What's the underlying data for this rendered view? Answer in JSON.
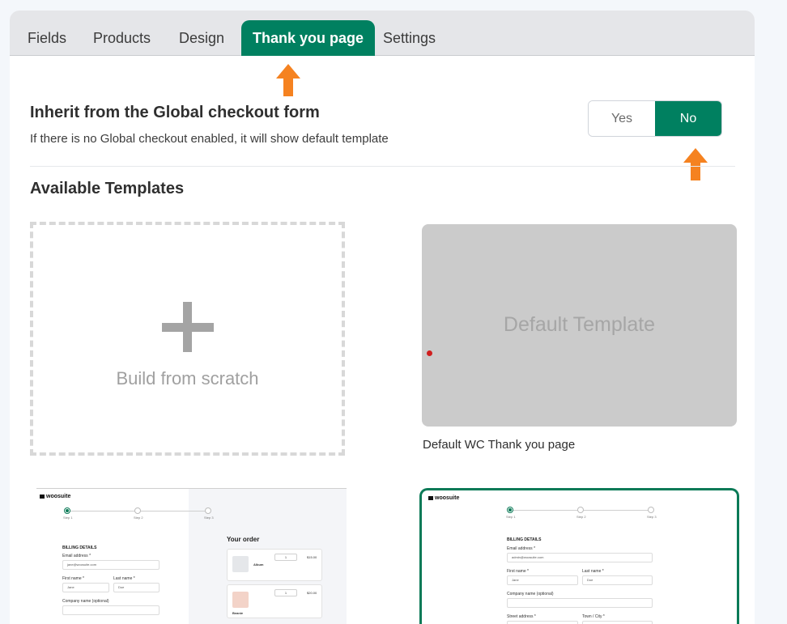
{
  "tabs": [
    {
      "label": "Fields",
      "active": false
    },
    {
      "label": "Products",
      "active": false
    },
    {
      "label": "Design",
      "active": false
    },
    {
      "label": "Thank you page",
      "active": true
    },
    {
      "label": "Settings",
      "active": false
    }
  ],
  "inherit": {
    "title": "Inherit from the Global checkout form",
    "subtitle": "If there is no Global checkout enabled, it will show default template",
    "yes_label": "Yes",
    "no_label": "No",
    "selected": "No"
  },
  "templates": {
    "title": "Available Templates",
    "scratch_label": "Build from scratch",
    "default_card_label": "Default Template",
    "default_caption": "Default WC Thank you page"
  },
  "preview": {
    "logo": "woosuite",
    "steps": [
      "Step 1",
      "Step 2",
      "Step 3"
    ],
    "billing_title": "BILLING DETAILS",
    "email_label": "Email address *",
    "email_value_1": "jane@woosuite.com",
    "email_value_2": "admin@woosuite.com",
    "first_name_label": "First name *",
    "last_name_label": "Last name *",
    "first_name_value": "Jane",
    "last_name_value": "Doe",
    "company_label": "Company name (optional)",
    "street_label": "Street address *",
    "town_label": "Town / City *",
    "order_title": "Your order",
    "items": [
      {
        "name": "Album",
        "qty": "1",
        "price": "$15.00"
      },
      {
        "name": "Beanie",
        "qty": "1",
        "price": "$20.00"
      }
    ]
  },
  "colors": {
    "accent": "#008060",
    "arrow": "#f58220",
    "tab_bar": "#e5e6e9",
    "card_gray": "#cbcbcb"
  }
}
